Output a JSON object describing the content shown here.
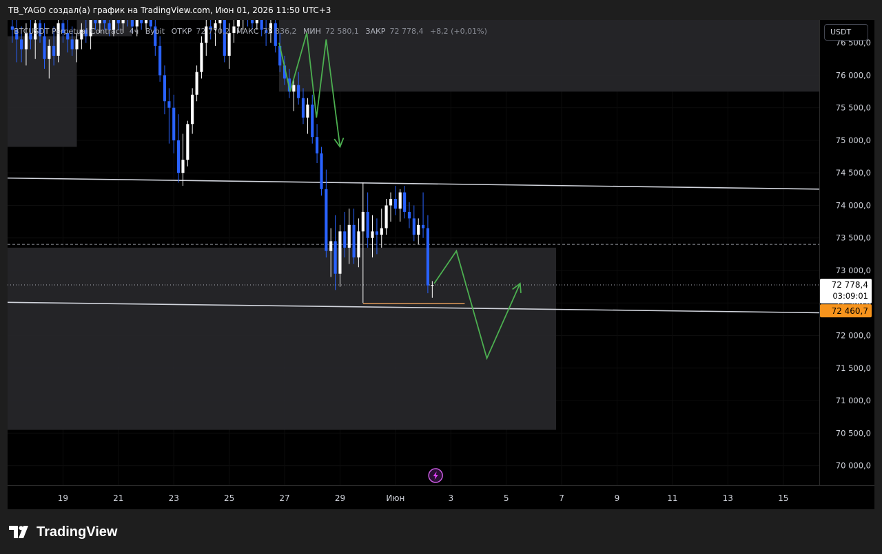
{
  "header": "TB_YAGO создал(а) график на TradingView.com, Июн 01, 2026 11:50 UTC+3",
  "legend": {
    "symbol": "BTCUSDT Perpetual Contract",
    "interval": "4ч",
    "exchange": "Bybit",
    "open_label": "ОТКР",
    "open": "72 770,2",
    "high_label": "МАКС",
    "high": "72 836,2",
    "low_label": "МИН",
    "low": "72 580,1",
    "close_label": "ЗАКР",
    "close": "72 778,4",
    "change": "+8,2 (+0,01%)"
  },
  "currency_button": "USDT",
  "brand": "TradingView",
  "colors": {
    "candle_up": "#ffffff",
    "candle_down": "#2962ff",
    "zone": "#2a2a2e",
    "trend_line": "#d1d4dc",
    "projection": "#4caf50",
    "level_line": "#f0a35e",
    "price_label_bg": "#ffffff",
    "level_label_bg": "#f7941d"
  },
  "chart_data": {
    "type": "candlestick",
    "y_axis": {
      "range": [
        69700,
        76850
      ],
      "ticks": [
        76500,
        76000,
        75500,
        75000,
        74500,
        74000,
        73500,
        73000,
        72500,
        72000,
        71500,
        71000,
        70500,
        70000
      ],
      "tick_labels": [
        "76 500,0",
        "76 000,0",
        "75 500,0",
        "75 000,0",
        "74 500,0",
        "74 000,0",
        "73 500,0",
        "73 000,0",
        "72 500,0",
        "72 000,0",
        "71 500,0",
        "71 000,0",
        "70 500,0",
        "70 000,0"
      ]
    },
    "x_axis": {
      "tick_labels": [
        "19",
        "21",
        "23",
        "25",
        "27",
        "29",
        "Июн",
        "3",
        "5",
        "7",
        "9",
        "11",
        "13",
        "15"
      ],
      "tick_positions": [
        1,
        3,
        5,
        7,
        9,
        11,
        13,
        15,
        17,
        19,
        21,
        23,
        25,
        27
      ],
      "range": [
        -1,
        28.3
      ]
    },
    "candles": [
      {
        "t": -0.83,
        "o": 76750,
        "h": 76900,
        "l": 76500,
        "c": 76700
      },
      {
        "t": -0.67,
        "o": 76700,
        "h": 76850,
        "l": 76200,
        "c": 76550
      },
      {
        "t": -0.5,
        "o": 76550,
        "h": 76750,
        "l": 76200,
        "c": 76400
      },
      {
        "t": -0.33,
        "o": 76400,
        "h": 76800,
        "l": 76150,
        "c": 76650
      },
      {
        "t": -0.17,
        "o": 76650,
        "h": 76900,
        "l": 76400,
        "c": 76550
      },
      {
        "t": 0.0,
        "o": 76550,
        "h": 76900,
        "l": 76250,
        "c": 76800
      },
      {
        "t": 0.17,
        "o": 76800,
        "h": 76950,
        "l": 76500,
        "c": 76600
      },
      {
        "t": 0.33,
        "o": 76600,
        "h": 76800,
        "l": 76100,
        "c": 76250
      },
      {
        "t": 0.5,
        "o": 76250,
        "h": 76550,
        "l": 75950,
        "c": 76450
      },
      {
        "t": 0.67,
        "o": 76450,
        "h": 76750,
        "l": 76150,
        "c": 76300
      },
      {
        "t": 0.83,
        "o": 76300,
        "h": 76900,
        "l": 76200,
        "c": 76800
      },
      {
        "t": 1.0,
        "o": 76800,
        "h": 76950,
        "l": 76500,
        "c": 76650
      },
      {
        "t": 1.17,
        "o": 76650,
        "h": 76850,
        "l": 76350,
        "c": 76550
      },
      {
        "t": 1.33,
        "o": 76550,
        "h": 76750,
        "l": 76300,
        "c": 76400
      },
      {
        "t": 1.5,
        "o": 76400,
        "h": 76650,
        "l": 76200,
        "c": 76550
      },
      {
        "t": 1.67,
        "o": 76550,
        "h": 76800,
        "l": 76400,
        "c": 76700
      },
      {
        "t": 1.83,
        "o": 76700,
        "h": 76900,
        "l": 76500,
        "c": 76600
      },
      {
        "t": 2.0,
        "o": 76600,
        "h": 76900,
        "l": 76400,
        "c": 76850
      },
      {
        "t": 2.17,
        "o": 76850,
        "h": 76950,
        "l": 76700,
        "c": 76800
      },
      {
        "t": 2.33,
        "o": 76800,
        "h": 76950,
        "l": 76650,
        "c": 76900
      },
      {
        "t": 2.5,
        "o": 76900,
        "h": 76950,
        "l": 76700,
        "c": 76800
      },
      {
        "t": 2.67,
        "o": 76800,
        "h": 76950,
        "l": 76600,
        "c": 76700
      },
      {
        "t": 2.83,
        "o": 76700,
        "h": 76950,
        "l": 76600,
        "c": 76850
      },
      {
        "t": 3.0,
        "o": 76850,
        "h": 76950,
        "l": 76700,
        "c": 76800
      },
      {
        "t": 3.17,
        "o": 76800,
        "h": 76950,
        "l": 76650,
        "c": 76900
      },
      {
        "t": 3.33,
        "o": 76900,
        "h": 76950,
        "l": 76750,
        "c": 76850
      },
      {
        "t": 3.5,
        "o": 76850,
        "h": 76950,
        "l": 76650,
        "c": 76750
      },
      {
        "t": 3.67,
        "o": 76750,
        "h": 76950,
        "l": 76600,
        "c": 76900
      },
      {
        "t": 3.83,
        "o": 76900,
        "h": 76950,
        "l": 76700,
        "c": 76800
      },
      {
        "t": 4.0,
        "o": 76800,
        "h": 76950,
        "l": 76700,
        "c": 76900
      },
      {
        "t": 4.17,
        "o": 76900,
        "h": 76950,
        "l": 76700,
        "c": 76750
      },
      {
        "t": 4.33,
        "o": 76750,
        "h": 76900,
        "l": 76300,
        "c": 76450
      },
      {
        "t": 4.5,
        "o": 76450,
        "h": 76600,
        "l": 75900,
        "c": 76000
      },
      {
        "t": 4.67,
        "o": 76000,
        "h": 76150,
        "l": 75400,
        "c": 75600
      },
      {
        "t": 4.83,
        "o": 75600,
        "h": 75800,
        "l": 74950,
        "c": 75500
      },
      {
        "t": 5.0,
        "o": 75500,
        "h": 75700,
        "l": 74800,
        "c": 75000
      },
      {
        "t": 5.17,
        "o": 75000,
        "h": 75400,
        "l": 74350,
        "c": 74500
      },
      {
        "t": 5.33,
        "o": 74500,
        "h": 75100,
        "l": 74300,
        "c": 74700
      },
      {
        "t": 5.5,
        "o": 74700,
        "h": 75300,
        "l": 74600,
        "c": 75250
      },
      {
        "t": 5.67,
        "o": 75250,
        "h": 75800,
        "l": 75100,
        "c": 75700
      },
      {
        "t": 5.83,
        "o": 75700,
        "h": 76150,
        "l": 75600,
        "c": 76050
      },
      {
        "t": 6.0,
        "o": 76050,
        "h": 76600,
        "l": 75950,
        "c": 76500
      },
      {
        "t": 6.17,
        "o": 76500,
        "h": 76850,
        "l": 76300,
        "c": 76750
      },
      {
        "t": 6.33,
        "o": 76750,
        "h": 76950,
        "l": 76550,
        "c": 76700
      },
      {
        "t": 6.5,
        "o": 76700,
        "h": 76950,
        "l": 76450,
        "c": 76800
      },
      {
        "t": 6.67,
        "o": 76800,
        "h": 76950,
        "l": 76650,
        "c": 76850
      },
      {
        "t": 6.83,
        "o": 76850,
        "h": 76950,
        "l": 76200,
        "c": 76300
      },
      {
        "t": 7.0,
        "o": 76300,
        "h": 76800,
        "l": 76100,
        "c": 76650
      },
      {
        "t": 7.17,
        "o": 76650,
        "h": 76900,
        "l": 76500,
        "c": 76750
      },
      {
        "t": 7.33,
        "o": 76750,
        "h": 76950,
        "l": 76650,
        "c": 76850
      },
      {
        "t": 7.5,
        "o": 76850,
        "h": 76950,
        "l": 76700,
        "c": 76900
      },
      {
        "t": 7.67,
        "o": 76900,
        "h": 76950,
        "l": 76750,
        "c": 76850
      },
      {
        "t": 7.83,
        "o": 76850,
        "h": 76950,
        "l": 76700,
        "c": 76800
      },
      {
        "t": 8.0,
        "o": 76800,
        "h": 76950,
        "l": 76700,
        "c": 76900
      },
      {
        "t": 8.17,
        "o": 76900,
        "h": 76950,
        "l": 76600,
        "c": 76700
      },
      {
        "t": 8.33,
        "o": 76700,
        "h": 76900,
        "l": 76450,
        "c": 76650
      },
      {
        "t": 8.5,
        "o": 76650,
        "h": 76950,
        "l": 76500,
        "c": 76800
      },
      {
        "t": 8.67,
        "o": 76800,
        "h": 76950,
        "l": 76350,
        "c": 76450
      },
      {
        "t": 8.83,
        "o": 76450,
        "h": 76650,
        "l": 76050,
        "c": 76150
      },
      {
        "t": 9.0,
        "o": 76150,
        "h": 76300,
        "l": 75850,
        "c": 75950
      },
      {
        "t": 9.17,
        "o": 75950,
        "h": 76100,
        "l": 75650,
        "c": 75750
      },
      {
        "t": 9.33,
        "o": 75750,
        "h": 75950,
        "l": 75450,
        "c": 75850
      },
      {
        "t": 9.5,
        "o": 75850,
        "h": 76050,
        "l": 75550,
        "c": 75650
      },
      {
        "t": 9.67,
        "o": 75650,
        "h": 75800,
        "l": 75250,
        "c": 75350
      },
      {
        "t": 9.83,
        "o": 75350,
        "h": 75650,
        "l": 75100,
        "c": 75550
      },
      {
        "t": 10.0,
        "o": 75550,
        "h": 75700,
        "l": 74950,
        "c": 75050
      },
      {
        "t": 10.17,
        "o": 75050,
        "h": 75250,
        "l": 74650,
        "c": 74800
      },
      {
        "t": 10.33,
        "o": 74800,
        "h": 74900,
        "l": 74150,
        "c": 74250
      },
      {
        "t": 10.5,
        "o": 74250,
        "h": 74550,
        "l": 73200,
        "c": 73300
      },
      {
        "t": 10.67,
        "o": 73300,
        "h": 73650,
        "l": 72900,
        "c": 73450
      },
      {
        "t": 10.83,
        "o": 73450,
        "h": 73850,
        "l": 72700,
        "c": 72950
      },
      {
        "t": 11.0,
        "o": 72950,
        "h": 73700,
        "l": 72750,
        "c": 73600
      },
      {
        "t": 11.17,
        "o": 73600,
        "h": 73900,
        "l": 73200,
        "c": 73350
      },
      {
        "t": 11.33,
        "o": 73350,
        "h": 73950,
        "l": 73100,
        "c": 73700
      },
      {
        "t": 11.5,
        "o": 73700,
        "h": 73950,
        "l": 73100,
        "c": 73200
      },
      {
        "t": 11.67,
        "o": 73200,
        "h": 73800,
        "l": 73050,
        "c": 73600
      },
      {
        "t": 11.83,
        "o": 73600,
        "h": 74350,
        "l": 72500,
        "c": 73900
      },
      {
        "t": 12.0,
        "o": 73900,
        "h": 74200,
        "l": 73350,
        "c": 73500
      },
      {
        "t": 12.17,
        "o": 73500,
        "h": 73850,
        "l": 73200,
        "c": 73600
      },
      {
        "t": 12.33,
        "o": 73600,
        "h": 73800,
        "l": 73250,
        "c": 73550
      },
      {
        "t": 12.5,
        "o": 73550,
        "h": 73950,
        "l": 73350,
        "c": 73650
      },
      {
        "t": 12.67,
        "o": 73650,
        "h": 74100,
        "l": 73550,
        "c": 74000
      },
      {
        "t": 12.83,
        "o": 74000,
        "h": 74200,
        "l": 73750,
        "c": 74100
      },
      {
        "t": 13.0,
        "o": 74100,
        "h": 74300,
        "l": 73850,
        "c": 73950
      },
      {
        "t": 13.17,
        "o": 73950,
        "h": 74250,
        "l": 73750,
        "c": 74200
      },
      {
        "t": 13.33,
        "o": 74200,
        "h": 74300,
        "l": 73800,
        "c": 73900
      },
      {
        "t": 13.5,
        "o": 73900,
        "h": 74050,
        "l": 73650,
        "c": 73800
      },
      {
        "t": 13.67,
        "o": 73800,
        "h": 74000,
        "l": 73450,
        "c": 73550
      },
      {
        "t": 13.83,
        "o": 73550,
        "h": 73800,
        "l": 73400,
        "c": 73700
      },
      {
        "t": 14.0,
        "o": 73700,
        "h": 74200,
        "l": 73500,
        "c": 73650
      },
      {
        "t": 14.17,
        "o": 73650,
        "h": 73850,
        "l": 72650,
        "c": 72770
      },
      {
        "t": 14.33,
        "o": 72770,
        "h": 72836,
        "l": 72580,
        "c": 72778
      }
    ],
    "horizontal_levels": [
      {
        "price": 73400,
        "style": "dashed"
      },
      {
        "price": 72778.4,
        "style": "dotted"
      }
    ],
    "trend_lines": [
      {
        "from": {
          "t": -1,
          "p": 74420
        },
        "to": {
          "t": 28.3,
          "p": 74250
        }
      },
      {
        "from": {
          "t": -1,
          "p": 72510
        },
        "to": {
          "t": 28.3,
          "p": 72350
        }
      }
    ],
    "support_level": {
      "price": 72490,
      "from_t": 11.83,
      "to_t": 15.5
    },
    "zones": [
      {
        "t1": -1,
        "t2": 1.5,
        "p1": 76600,
        "p2": 74900
      },
      {
        "t1": 1.5,
        "t2": 3.5,
        "p1": 76900,
        "p2": 76600
      },
      {
        "t1": 8.8,
        "t2": 28.3,
        "p1": 77000,
        "p2": 75750
      },
      {
        "t1": -1,
        "t2": 18.8,
        "p1": 73350,
        "p2": 70550
      }
    ],
    "projection_paths": [
      {
        "points": [
          [
            8.8,
            76500
          ],
          [
            9.2,
            75750
          ],
          [
            9.8,
            76650
          ],
          [
            10.15,
            75350
          ],
          [
            10.5,
            76550
          ],
          [
            11.0,
            74900
          ]
        ],
        "arrow": true
      },
      {
        "points": [
          [
            14.4,
            72800
          ],
          [
            15.2,
            73300
          ],
          [
            16.3,
            71650
          ],
          [
            17.5,
            72800
          ]
        ],
        "arrow": true
      }
    ],
    "last_price": {
      "value": "72 778,4",
      "countdown": "03:09:01"
    },
    "level_label": "72 460,7",
    "alert_marker": {
      "t": 14.45
    }
  }
}
